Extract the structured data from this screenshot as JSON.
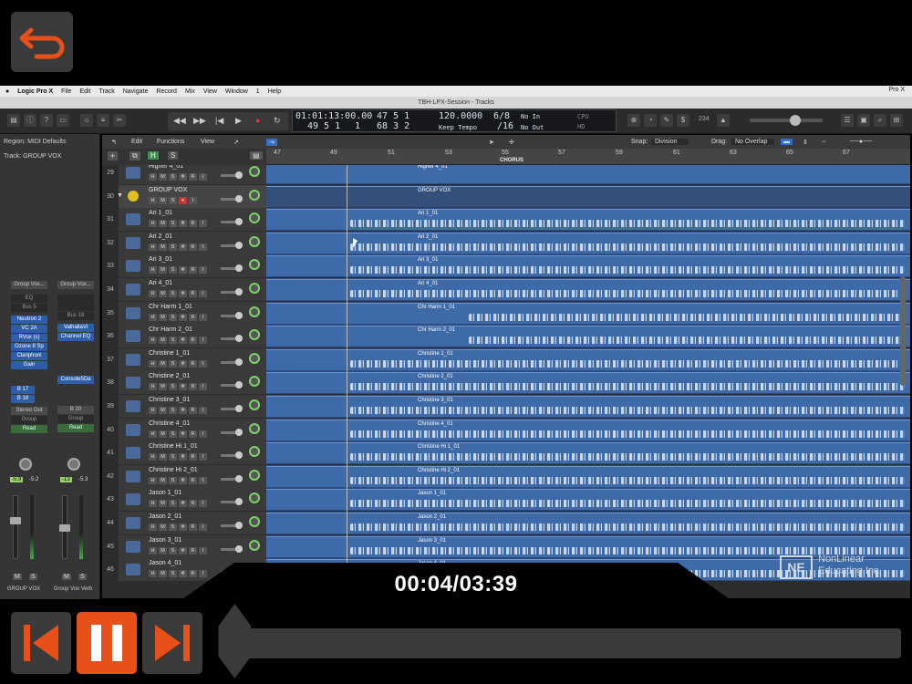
{
  "menubar": {
    "app": "Logic Pro X",
    "items": [
      "File",
      "Edit",
      "Track",
      "Navigate",
      "Record",
      "Mix",
      "View",
      "Window",
      "1",
      "Help"
    ],
    "clock": "Pro X"
  },
  "window_title": "TBH-LPX-Session - Tracks",
  "lcd": {
    "time": "01:01:13:00.00",
    "bars_top": "47  5  1",
    "bars_top_tick": "1",
    "bars_bottom": "49  5  1",
    "bars_bottom_tick": "1",
    "locator_top": "47  5  1",
    "locator_bottom": "68  3  2",
    "tempo": "120.0000",
    "tempo_mode": "Keep Tempo",
    "signature": "6/8",
    "division": "/16",
    "in": "No In",
    "out": "No Out"
  },
  "toolbar_extra": {
    "cpu_label": "CPU",
    "hd_label": "HD",
    "counter": "234"
  },
  "inspector": {
    "region": "Region: MIDI Defaults",
    "track": "Track: GROUP VOX",
    "strip1": {
      "setting": "Group Vox...",
      "eq": "EQ",
      "bus": "Bus 5",
      "plugins": [
        "Neutron 2",
        "VC 2A",
        "RVox (s)",
        "Ozone 8 Sp",
        "Clariphoni",
        "Gain"
      ],
      "sends": [
        "B 17",
        "B 18"
      ],
      "output": "Stereo Out",
      "group": "Group",
      "automation": "Read",
      "values": [
        "-5.9",
        "-5.2"
      ],
      "name": "GROUP VOX"
    },
    "strip2": {
      "setting": "Group Vox...",
      "bus": "Bus 18",
      "plugins": [
        "ValhallaVi",
        "Channel EQ"
      ],
      "extra_plugin": "Console5Da",
      "output": "B 20",
      "group": "Group",
      "automation": "Read",
      "values": [
        "-13",
        "-5.3"
      ],
      "name": "Group Vox Verb"
    },
    "ms": [
      "M",
      "S"
    ]
  },
  "arrange": {
    "menus": [
      "Edit",
      "Functions",
      "View"
    ],
    "snap_label": "Snap:",
    "snap_value": "Division",
    "drag_label": "Drag:",
    "drag_value": "No Overlap",
    "ruler": [
      "47",
      "49",
      "51",
      "53",
      "55",
      "57",
      "59",
      "61",
      "63",
      "65",
      "67"
    ],
    "marker": "CHORUS",
    "track_buttons": [
      "H",
      "M",
      "S",
      "R",
      "I"
    ],
    "tracks": [
      {
        "num": "29",
        "name": "Higher 4_01",
        "region": "Higher 4_01"
      },
      {
        "num": "30",
        "name": "GROUP VOX",
        "region": "GROUP VOX"
      },
      {
        "num": "31",
        "name": "Ari 1_01",
        "region": "Ari 1_01"
      },
      {
        "num": "32",
        "name": "Ari 2_01",
        "region": "Ari 2_01"
      },
      {
        "num": "33",
        "name": "Ari 3_01",
        "region": "Ari 3_01"
      },
      {
        "num": "34",
        "name": "Ari 4_01",
        "region": "Ari 4_01"
      },
      {
        "num": "35",
        "name": "Chr Harm 1_01",
        "region": "Chr Harm 1_01"
      },
      {
        "num": "36",
        "name": "Chr Harm 2_01",
        "region": "Chr Harm 2_01"
      },
      {
        "num": "37",
        "name": "Christine 1_01",
        "region": "Christine 1_01"
      },
      {
        "num": "38",
        "name": "Christine 2_01",
        "region": "Christine 2_01"
      },
      {
        "num": "39",
        "name": "Christine 3_01",
        "region": "Christine 3_01"
      },
      {
        "num": "40",
        "name": "Christine 4_01",
        "region": "Christine 4_01"
      },
      {
        "num": "41",
        "name": "Christine Hi 1_01",
        "region": "Christine Hi 1_01"
      },
      {
        "num": "42",
        "name": "Christine Hi 2_01",
        "region": "Christine Hi 2_01"
      },
      {
        "num": "43",
        "name": "Jason 1_01",
        "region": "Jason 1_01"
      },
      {
        "num": "44",
        "name": "Jason 2_01",
        "region": "Jason 2_01"
      },
      {
        "num": "45",
        "name": "Jason 3_01",
        "region": "Jason 3_01"
      },
      {
        "num": "46",
        "name": "Jason 4_01",
        "region": "Jason 4_01"
      }
    ]
  },
  "watermark": {
    "box": "NE",
    "line1": "NonLinear",
    "line2": "Educating Inc."
  },
  "player": {
    "time": "00:04/03:39",
    "progress": 0.018
  },
  "colors": {
    "accent": "#e8501a",
    "region": "#3f6aa8",
    "waveform": "#c9d7ea"
  }
}
